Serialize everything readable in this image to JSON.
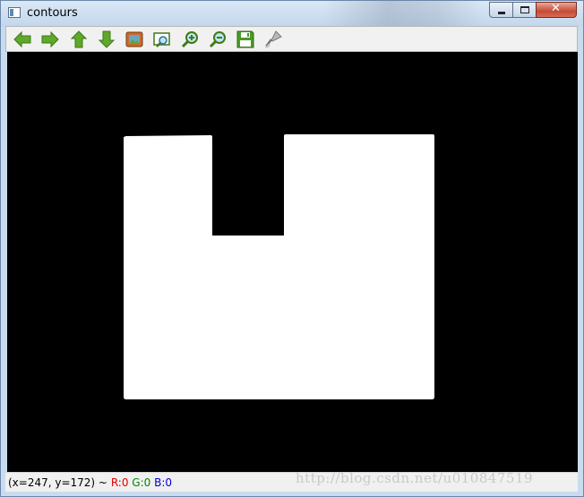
{
  "window": {
    "title": "contours",
    "controls": {
      "minimize": "minimize",
      "maximize": "maximize",
      "close": "✕"
    }
  },
  "toolbar": {
    "tools": [
      {
        "icon": "arrow-left-icon",
        "label": "Pan left"
      },
      {
        "icon": "arrow-right-icon",
        "label": "Pan right"
      },
      {
        "icon": "arrow-up-icon",
        "label": "Pan up"
      },
      {
        "icon": "arrow-down-icon",
        "label": "Pan down"
      },
      {
        "icon": "reset-zoom-icon",
        "label": "Reset zoom"
      },
      {
        "icon": "zoom-rect-icon",
        "label": "Zoom rectangle"
      },
      {
        "icon": "zoom-in-icon",
        "label": "Zoom in"
      },
      {
        "icon": "zoom-out-icon",
        "label": "Zoom out"
      },
      {
        "icon": "save-icon",
        "label": "Save"
      },
      {
        "icon": "properties-icon",
        "label": "Properties"
      }
    ]
  },
  "image": {
    "background": "#000000",
    "foreground": "#ffffff"
  },
  "status": {
    "coords": "(x=247, y=172) ~",
    "r": "R:0",
    "g": "G:0",
    "b": "B:0",
    "colors": {
      "r": "#e00000",
      "g": "#008a00",
      "b": "#0000d8"
    }
  },
  "watermark": "http://blog.csdn.net/u010847519"
}
